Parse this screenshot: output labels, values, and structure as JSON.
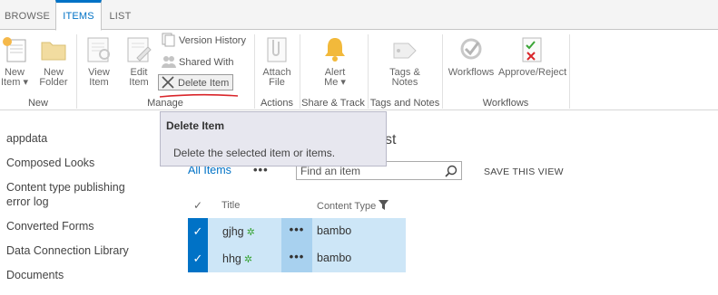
{
  "tabs": [
    {
      "label": "BROWSE"
    },
    {
      "label": "ITEMS"
    },
    {
      "label": "LIST"
    }
  ],
  "ribbon": {
    "new": {
      "new_item_l1": "New",
      "new_item_l2": "Item",
      "new_folder_l1": "New",
      "new_folder_l2": "Folder",
      "group": "New"
    },
    "manage": {
      "view_l1": "View",
      "view_l2": "Item",
      "edit_l1": "Edit",
      "edit_l2": "Item",
      "version_history": "Version History",
      "shared_with": "Shared With",
      "delete_item": "Delete Item",
      "group": "Manage"
    },
    "actions": {
      "attach_l1": "Attach",
      "attach_l2": "File",
      "group": "Actions"
    },
    "share_track": {
      "alert_l1": "Alert",
      "alert_l2": "Me",
      "group": "Share & Track"
    },
    "tags": {
      "tags_l1": "Tags &",
      "tags_l2": "Notes",
      "group": "Tags and Notes"
    },
    "workflows": {
      "workflows": "Workflows",
      "approve_reject": "Approve/Reject",
      "group": "Workflows"
    }
  },
  "tooltip": {
    "title": "Delete Item",
    "body": "Delete the selected item or items."
  },
  "nav": {
    "items": [
      {
        "label": "appdata"
      },
      {
        "label": "Composed Looks"
      },
      {
        "label": "Content type publishing"
      },
      {
        "label": "error log"
      },
      {
        "label": "Converted Forms"
      },
      {
        "label": "Data Connection Library"
      },
      {
        "label": "Documents"
      }
    ]
  },
  "page_title_tail": "st",
  "view": {
    "all_items": "All Items",
    "ellipsis": "•••",
    "search_placeholder": "Find an item",
    "save_view": "SAVE THIS VIEW"
  },
  "list": {
    "headers": {
      "check": "✓",
      "title": "Title",
      "content_type": "Content Type"
    },
    "rows": [
      {
        "title": "gjhg",
        "new_marker": "✲",
        "dots": "•••",
        "content_type": "bambo",
        "check": "✓"
      },
      {
        "title": "hhg",
        "new_marker": "✲",
        "dots": "•••",
        "content_type": "bambo",
        "check": "✓"
      }
    ]
  },
  "colors": {
    "accent": "#0072c6",
    "selected_row": "#cde6f7",
    "annotation_red": "#d9252a"
  }
}
